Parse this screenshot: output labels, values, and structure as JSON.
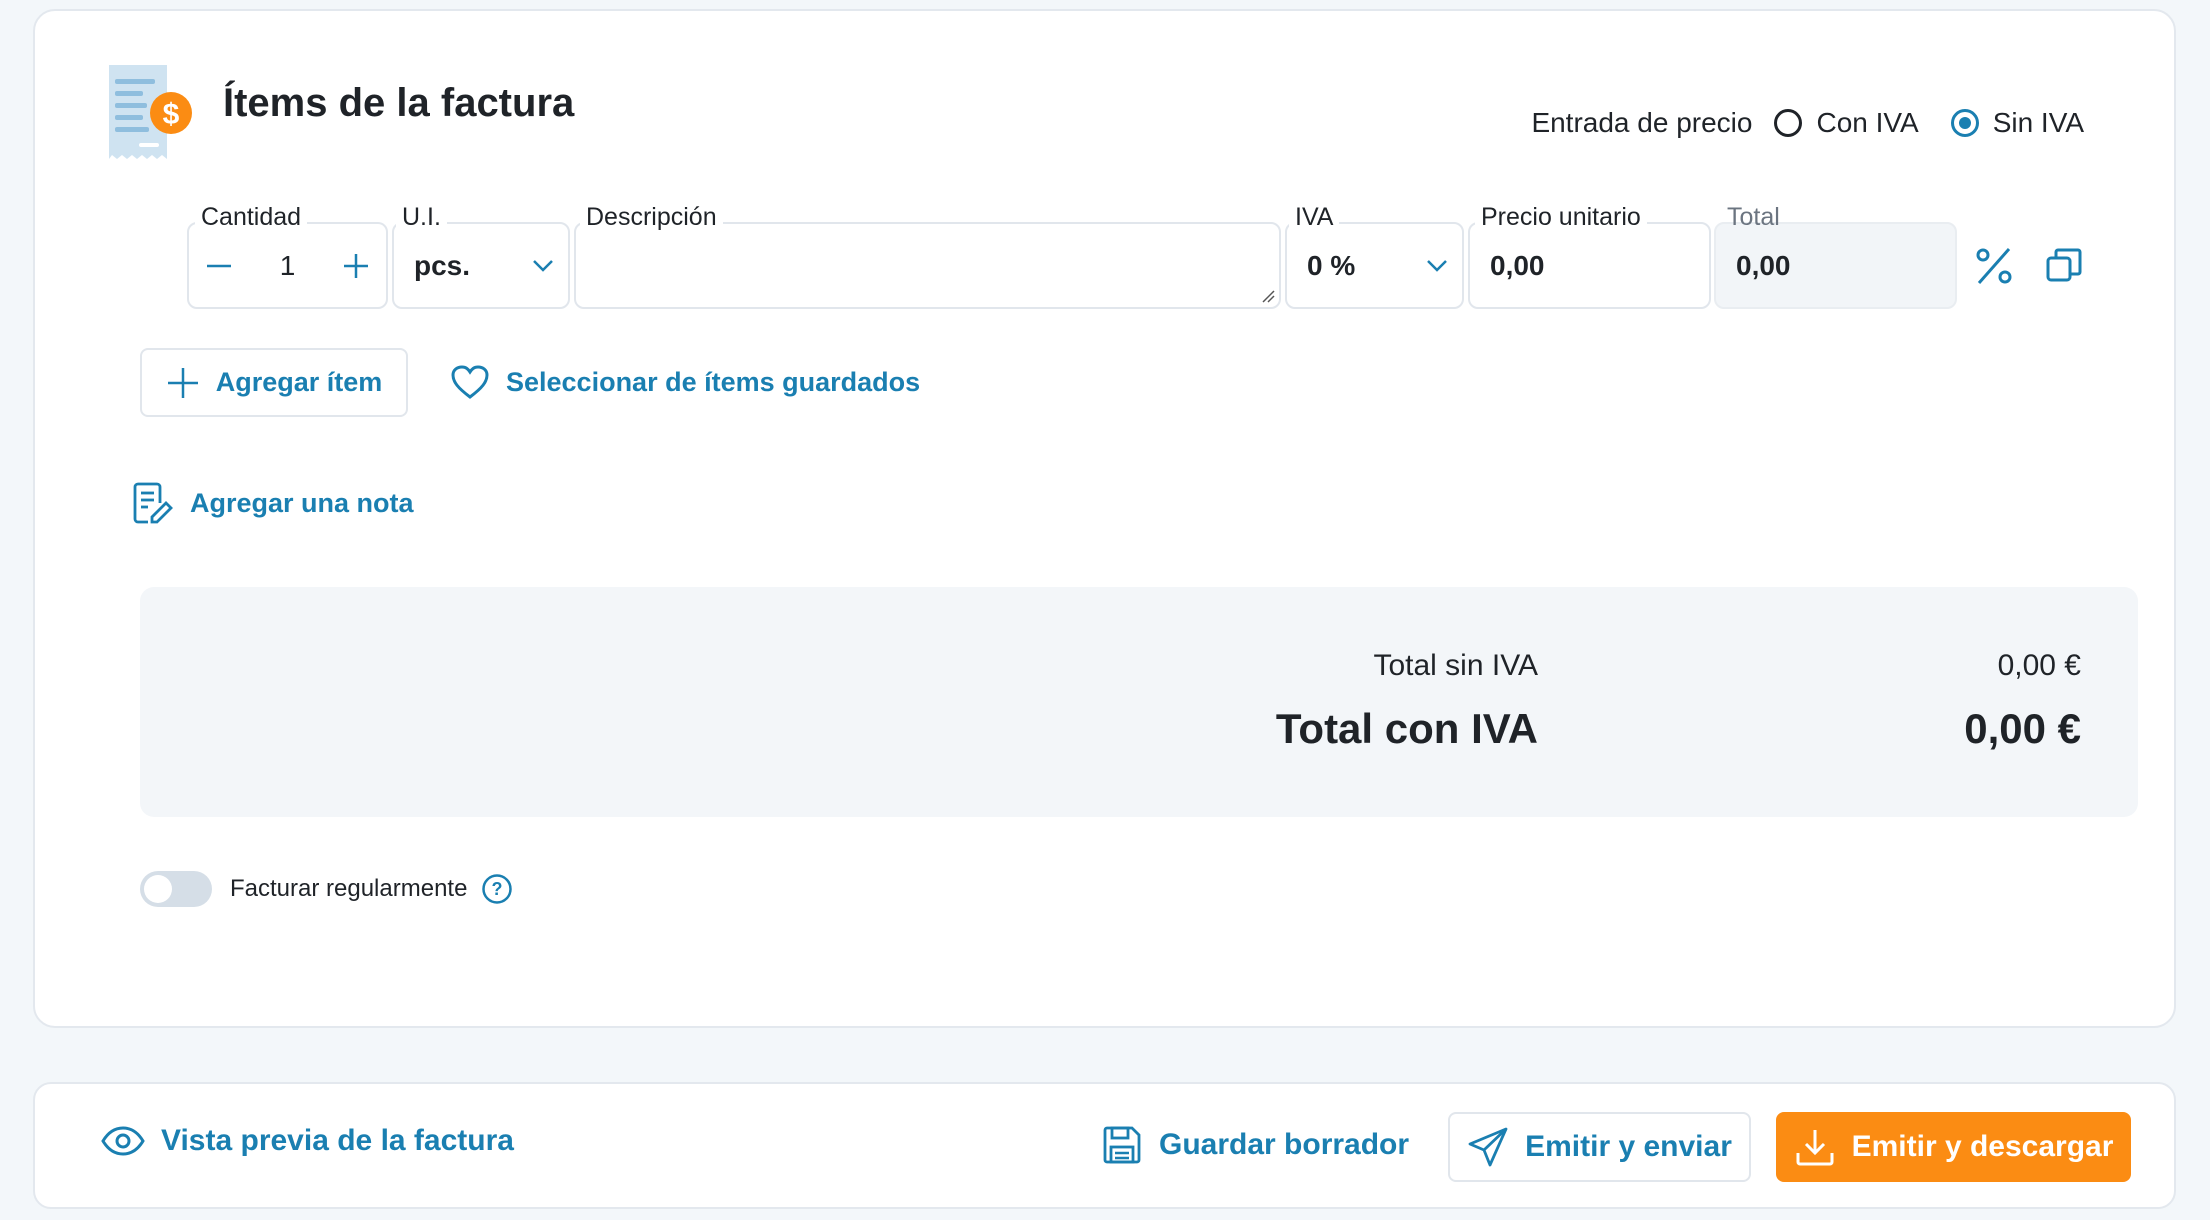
{
  "section": {
    "title": "Ítems de la factura",
    "icon": "invoice-dollar-icon",
    "price_entry": {
      "label": "Entrada de precio",
      "options": [
        {
          "label": "Con IVA",
          "selected": false
        },
        {
          "label": "Sin IVA",
          "selected": true
        }
      ]
    }
  },
  "item_row": {
    "quantity": {
      "label": "Cantidad",
      "value": "1"
    },
    "unit": {
      "label": "U.I.",
      "value": "pcs."
    },
    "description": {
      "label": "Descripción",
      "value": ""
    },
    "vat": {
      "label": "IVA",
      "value": "0 %"
    },
    "unit_price": {
      "label": "Precio unitario",
      "value": "0,00"
    },
    "total": {
      "label": "Total",
      "value": "0,00"
    }
  },
  "actions": {
    "add_item": "Agregar ítem",
    "select_saved": "Seleccionar de ítems guardados",
    "add_note": "Agregar una nota"
  },
  "totals": {
    "subtotal_label": "Total sin IVA",
    "subtotal_value": "0,00 €",
    "total_label": "Total con IVA",
    "total_value": "0,00 €"
  },
  "recurring": {
    "label": "Facturar regularmente",
    "enabled": false
  },
  "footer": {
    "preview": "Vista previa de la factura",
    "save_draft": "Guardar borrador",
    "issue_send": "Emitir y enviar",
    "issue_download": "Emitir y descargar"
  },
  "colors": {
    "accent": "#1a7fb1",
    "primary_button": "#fb8c13",
    "background": "#f3f7fa"
  }
}
